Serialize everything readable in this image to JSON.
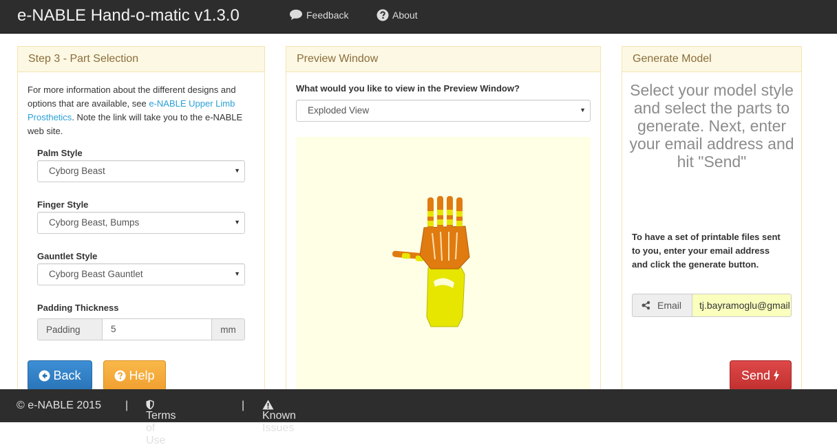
{
  "app": {
    "title": "e-NABLE Hand-o-matic v1.3.0"
  },
  "nav": {
    "feedback": "Feedback",
    "about": "About"
  },
  "step_panel": {
    "heading": "Step 3 - Part Selection",
    "info_before": "For more information about the different designs and options that are available, see ",
    "info_link": "e-NABLE Upper Limb Prosthetics",
    "info_after": ". Note the link will take you to the e-NABLE web site.",
    "palm_label": "Palm Style",
    "palm_value": "Cyborg Beast",
    "finger_label": "Finger Style",
    "finger_value": "Cyborg Beast, Bumps",
    "gauntlet_label": "Gauntlet Style",
    "gauntlet_value": "Cyborg Beast Gauntlet",
    "padding_label": "Padding Thickness",
    "padding_addon": "Padding",
    "padding_value": "5",
    "padding_unit": "mm",
    "back_button": "Back",
    "help_button": "Help"
  },
  "preview_panel": {
    "heading": "Preview Window",
    "question": "What would you like to view in the Preview Window?",
    "view_value": "Exploded View"
  },
  "generate_panel": {
    "heading": "Generate Model",
    "instructions": "Select your model style and select the parts to generate. Next, enter your email address and hit \"Send\"",
    "info": "To have a set of printable files sent to you, enter your email address and click the generate button.",
    "email_addon": "Email",
    "email_value": "tj.bayramoglu@gmail.com",
    "send_button": "Send"
  },
  "footer": {
    "copyright": "© e-NABLE 2015",
    "separator": "|",
    "terms": "Terms of Use",
    "issues": "Known Issues"
  },
  "colors": {
    "navbar": "#2d2d2d",
    "panel_header": "#fcf8e3",
    "panel_border": "#f5e3b0",
    "link": "#2a9fd6",
    "back": "#2a74b8",
    "help": "#f0a030",
    "send": "#c0302f",
    "preview_bg": "#ffffe6",
    "model_orange": "#e07b10",
    "model_yellow": "#e8e800"
  }
}
